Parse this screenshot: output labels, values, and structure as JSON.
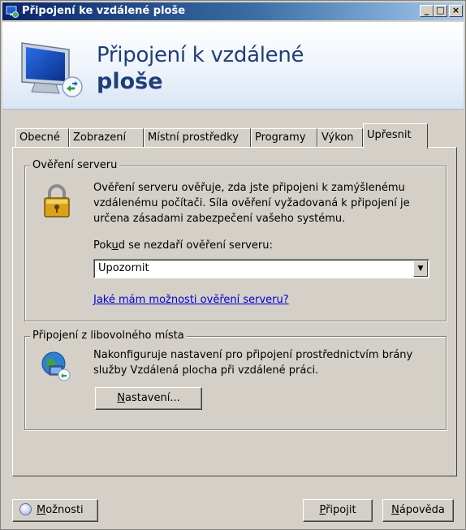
{
  "window": {
    "title": "Připojení ke vzdálené ploše",
    "controls": {
      "minimize": "_",
      "maximize": "□",
      "close": "×"
    }
  },
  "banner": {
    "line1": "Připojení k vzdálené",
    "line2": "ploše"
  },
  "tabs": [
    {
      "label": "Obecné",
      "active": false
    },
    {
      "label": "Zobrazení",
      "active": false
    },
    {
      "label": "Místní prostředky",
      "active": false
    },
    {
      "label": "Programy",
      "active": false
    },
    {
      "label": "Výkon",
      "active": false
    },
    {
      "label": "Upřesnit",
      "active": true
    }
  ],
  "server_auth": {
    "legend": "Ověření serveru",
    "description": [
      "Ověření serveru ověřuje, zda jste připojeni k zamýšlenému",
      "vzdálenému počítači. Síla ověření vyžadovaná k připojení je",
      "určena zásadami zabezpečení vašeho systému."
    ],
    "fail_label_pre": "Pok",
    "fail_label_ul": "u",
    "fail_label_post": "d se nezdaří ověření serveru:",
    "selected_option": "Upozornit",
    "help_link": "Jaké mám možnosti ověření serveru?"
  },
  "connect_anywhere": {
    "legend": "Připojení z libovolného místa",
    "description": [
      "Nakonfiguruje nastavení pro připojení prostřednictvím brány",
      "služby Vzdálená plocha při vzdálené práci."
    ],
    "settings_button_ul": "N",
    "settings_button_rest": "astavení..."
  },
  "footer": {
    "options_ul": "M",
    "options_rest": "ožnosti",
    "connect_ul": "P",
    "connect_rest": "řipojit",
    "help_ul": "N",
    "help_rest": "ápověda"
  }
}
